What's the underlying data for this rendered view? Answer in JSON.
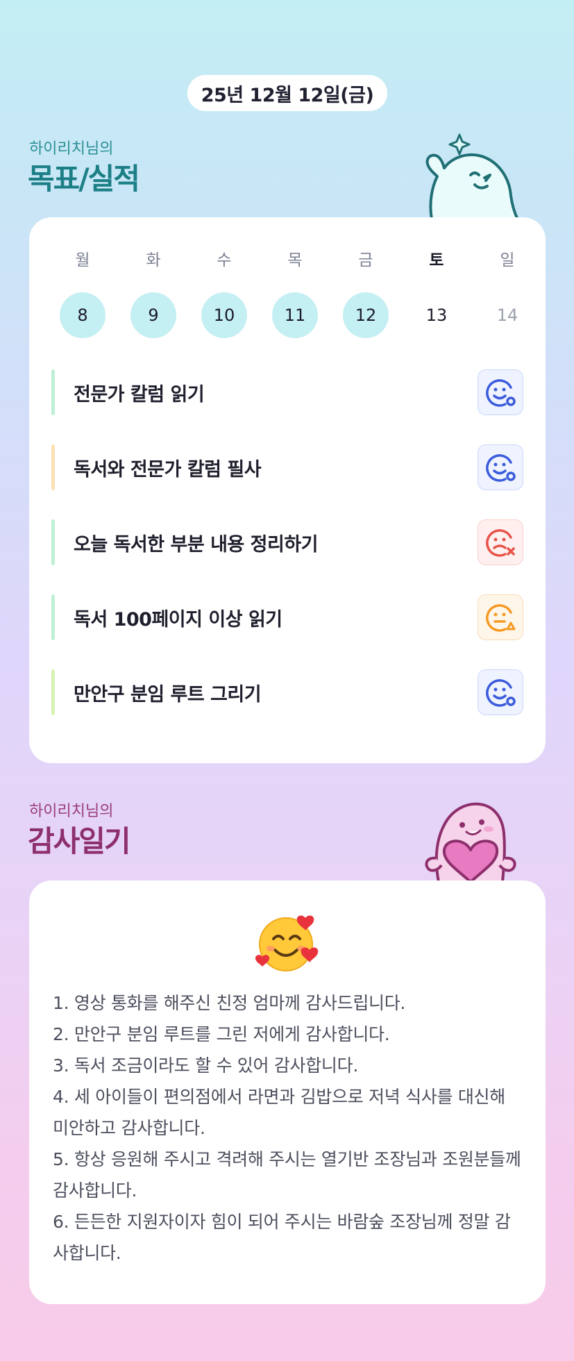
{
  "date": "25년 12월 12일(금)",
  "goals_section": {
    "subtitle": "하이리치님의",
    "title": "목표/실적"
  },
  "week": [
    {
      "label": "월",
      "day": "8",
      "state": "done"
    },
    {
      "label": "화",
      "day": "9",
      "state": "done"
    },
    {
      "label": "수",
      "day": "10",
      "state": "done"
    },
    {
      "label": "목",
      "day": "11",
      "state": "done"
    },
    {
      "label": "금",
      "day": "12",
      "state": "done"
    },
    {
      "label": "토",
      "day": "13",
      "state": "today"
    },
    {
      "label": "일",
      "day": "14",
      "state": "future"
    }
  ],
  "goals": [
    {
      "text": "전문가 칼럼 읽기",
      "bar_color": "#bff0d6",
      "status": "achieved",
      "status_icon": "smile-circle-icon"
    },
    {
      "text": "독서와 전문가 칼럼 필사",
      "bar_color": "#fde0b4",
      "status": "achieved",
      "status_icon": "smile-circle-icon"
    },
    {
      "text": "오늘 독서한 부분 내용 정리하기",
      "bar_color": "#bff0d6",
      "status": "failed",
      "status_icon": "sad-x-icon"
    },
    {
      "text": "독서 100페이지 이상 읽기",
      "bar_color": "#bff0d6",
      "status": "partial",
      "status_icon": "neutral-triangle-icon"
    },
    {
      "text": "만안구 분임 루트 그리기",
      "bar_color": "#d7f2b4",
      "status": "achieved",
      "status_icon": "smile-circle-icon"
    }
  ],
  "thanks_section": {
    "subtitle": "하이리치님의",
    "title": "감사일기",
    "emoji_icon": "smiling-face-with-hearts-icon",
    "lines": [
      "1. 영상 통화를 해주신 친정 엄마께 감사드립니다.",
      "2. 만안구 분임 루트를 그린 저에게 감사합니다.",
      "3. 독서 조금이라도 할 수 있어 감사합니다.",
      "4. 세 아이들이 편의점에서 라면과 김밥으로 저녁 식사를 대신해 미안하고 감사합니다.",
      "5. 항상 응원해 주시고 격려해 주시는 열기반 조장님과 조원분들께 감사합니다.",
      "6. 든든한 지원자이자 힘이 되어 주시는 바람숲 조장님께 정말 감사합니다."
    ]
  },
  "colors": {
    "achieved": "#3b5bdb",
    "failed": "#e8534a",
    "partial": "#f59a23",
    "done_day": "#c4eff3"
  }
}
